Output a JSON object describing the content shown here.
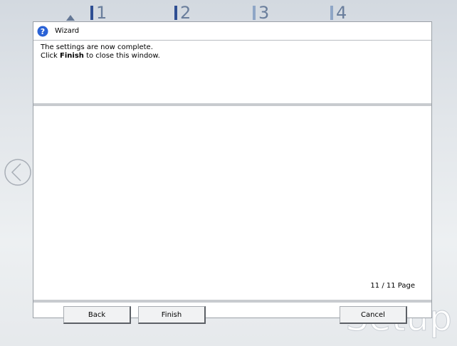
{
  "background": {
    "steps": [
      "1",
      "2",
      "3",
      "4"
    ],
    "watermark": "Setup",
    "prev_icon": "circle-chevron-left-icon"
  },
  "dialog": {
    "title": "Wizard",
    "title_icon": "question-circle-icon",
    "message_line1": "The settings are now complete.",
    "message_line2_prefix": "Click ",
    "message_line2_bold": "Finish",
    "message_line2_suffix": " to close this window.",
    "page_indicator": "11 / 11 Page"
  },
  "buttons": {
    "back": "Back",
    "finish": "Finish",
    "cancel": "Cancel"
  },
  "colors": {
    "icon_blue": "#2a62d6",
    "step_active": "#2f4f93",
    "step_inactive": "#8fa6c6"
  }
}
